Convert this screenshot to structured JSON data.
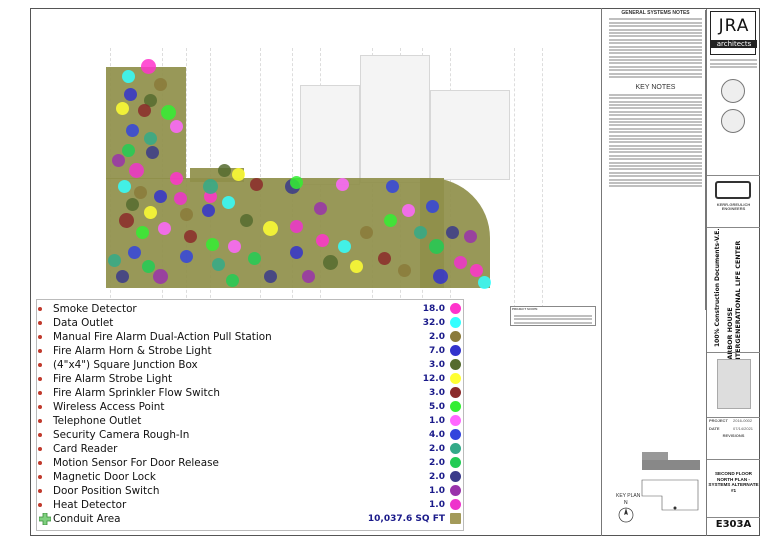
{
  "general_notes_title": "GENERAL SYSTEMS NOTES",
  "key_notes_title": "KEY NOTES",
  "note_box_title": "PROJECT SCOPE",
  "legend": {
    "items": [
      {
        "label": "Smoke Detector",
        "count": "18.0",
        "color": "#ff33cc",
        "shape": "circle"
      },
      {
        "label": "Data Outlet",
        "count": "32.0",
        "color": "#33ffff",
        "shape": "circle"
      },
      {
        "label": "Manual Fire Alarm Dual-Action Pull Station",
        "count": "2.0",
        "color": "#8a7a3a",
        "shape": "circle"
      },
      {
        "label": "Fire Alarm Horn & Strobe Light",
        "count": "7.0",
        "color": "#3333cc",
        "shape": "circle"
      },
      {
        "label": "(4\"x4\") Square Junction Box",
        "count": "3.0",
        "color": "#556b2f",
        "shape": "circle"
      },
      {
        "label": "Fire Alarm Strobe Light",
        "count": "12.0",
        "color": "#ffff33",
        "shape": "circle"
      },
      {
        "label": "Fire Alarm Sprinkler Flow Switch",
        "count": "3.0",
        "color": "#8b2a2a",
        "shape": "circle"
      },
      {
        "label": "Wireless Access Point",
        "count": "5.0",
        "color": "#33ee33",
        "shape": "circle"
      },
      {
        "label": "Telephone Outlet",
        "count": "1.0",
        "color": "#ff66ff",
        "shape": "circle"
      },
      {
        "label": "Security Camera Rough-In",
        "count": "4.0",
        "color": "#3344dd",
        "shape": "circle"
      },
      {
        "label": "Card Reader",
        "count": "2.0",
        "color": "#33aa88",
        "shape": "circle"
      },
      {
        "label": "Motion Sensor For Door Release",
        "count": "2.0",
        "color": "#22cc55",
        "shape": "circle"
      },
      {
        "label": "Magnetic Door Lock",
        "count": "2.0",
        "color": "#3a3a8a",
        "shape": "circle"
      },
      {
        "label": "Door Position Switch",
        "count": "1.0",
        "color": "#9933aa",
        "shape": "circle"
      },
      {
        "label": "Heat Detector",
        "count": "1.0",
        "color": "#ee33cc",
        "shape": "circle"
      },
      {
        "label": "Conduit Area",
        "count": "10,037.6 SQ FT",
        "color": "#a39a5a",
        "shape": "square"
      }
    ]
  },
  "titleblock": {
    "firm_mark": "JRA",
    "firm_name": "architects",
    "project_vertical": "100% Construction Documents-V.E.",
    "project_name_vertical": "HARBOR HOUSE INTERGENERATIONAL LIFE CENTER",
    "consultant_name": "KERR-GREULICH ENGINEERS",
    "sheet_title": "SECOND FLOOR NORTH PLAN - SYSTEMS ALTERNATE #1",
    "sheet_number": "E303A",
    "revisions_label": "REVISIONS",
    "project_label": "PROJECT",
    "project_no": "2016-0002",
    "date_label": "DATE",
    "date_value": "07/14/2021"
  },
  "key_plan_label": "KEY PLAN",
  "north_label": "N"
}
